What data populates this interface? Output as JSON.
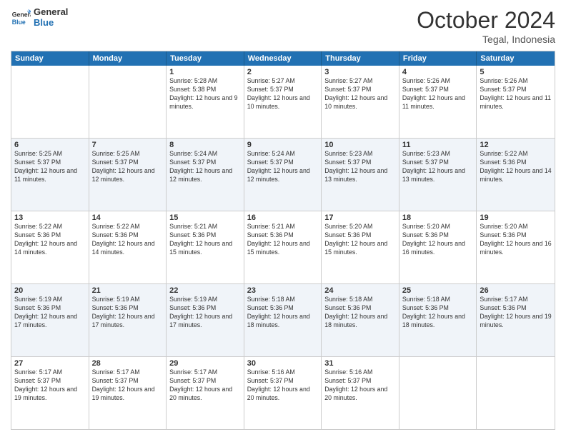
{
  "logo": {
    "line1": "General",
    "line2": "Blue"
  },
  "title": "October 2024",
  "location": "Tegal, Indonesia",
  "header_days": [
    "Sunday",
    "Monday",
    "Tuesday",
    "Wednesday",
    "Thursday",
    "Friday",
    "Saturday"
  ],
  "rows": [
    {
      "alt": false,
      "cells": [
        {
          "day": "",
          "info": ""
        },
        {
          "day": "",
          "info": ""
        },
        {
          "day": "1",
          "info": "Sunrise: 5:28 AM\nSunset: 5:38 PM\nDaylight: 12 hours and 9 minutes."
        },
        {
          "day": "2",
          "info": "Sunrise: 5:27 AM\nSunset: 5:37 PM\nDaylight: 12 hours and 10 minutes."
        },
        {
          "day": "3",
          "info": "Sunrise: 5:27 AM\nSunset: 5:37 PM\nDaylight: 12 hours and 10 minutes."
        },
        {
          "day": "4",
          "info": "Sunrise: 5:26 AM\nSunset: 5:37 PM\nDaylight: 12 hours and 11 minutes."
        },
        {
          "day": "5",
          "info": "Sunrise: 5:26 AM\nSunset: 5:37 PM\nDaylight: 12 hours and 11 minutes."
        }
      ]
    },
    {
      "alt": true,
      "cells": [
        {
          "day": "6",
          "info": "Sunrise: 5:25 AM\nSunset: 5:37 PM\nDaylight: 12 hours and 11 minutes."
        },
        {
          "day": "7",
          "info": "Sunrise: 5:25 AM\nSunset: 5:37 PM\nDaylight: 12 hours and 12 minutes."
        },
        {
          "day": "8",
          "info": "Sunrise: 5:24 AM\nSunset: 5:37 PM\nDaylight: 12 hours and 12 minutes."
        },
        {
          "day": "9",
          "info": "Sunrise: 5:24 AM\nSunset: 5:37 PM\nDaylight: 12 hours and 12 minutes."
        },
        {
          "day": "10",
          "info": "Sunrise: 5:23 AM\nSunset: 5:37 PM\nDaylight: 12 hours and 13 minutes."
        },
        {
          "day": "11",
          "info": "Sunrise: 5:23 AM\nSunset: 5:37 PM\nDaylight: 12 hours and 13 minutes."
        },
        {
          "day": "12",
          "info": "Sunrise: 5:22 AM\nSunset: 5:36 PM\nDaylight: 12 hours and 14 minutes."
        }
      ]
    },
    {
      "alt": false,
      "cells": [
        {
          "day": "13",
          "info": "Sunrise: 5:22 AM\nSunset: 5:36 PM\nDaylight: 12 hours and 14 minutes."
        },
        {
          "day": "14",
          "info": "Sunrise: 5:22 AM\nSunset: 5:36 PM\nDaylight: 12 hours and 14 minutes."
        },
        {
          "day": "15",
          "info": "Sunrise: 5:21 AM\nSunset: 5:36 PM\nDaylight: 12 hours and 15 minutes."
        },
        {
          "day": "16",
          "info": "Sunrise: 5:21 AM\nSunset: 5:36 PM\nDaylight: 12 hours and 15 minutes."
        },
        {
          "day": "17",
          "info": "Sunrise: 5:20 AM\nSunset: 5:36 PM\nDaylight: 12 hours and 15 minutes."
        },
        {
          "day": "18",
          "info": "Sunrise: 5:20 AM\nSunset: 5:36 PM\nDaylight: 12 hours and 16 minutes."
        },
        {
          "day": "19",
          "info": "Sunrise: 5:20 AM\nSunset: 5:36 PM\nDaylight: 12 hours and 16 minutes."
        }
      ]
    },
    {
      "alt": true,
      "cells": [
        {
          "day": "20",
          "info": "Sunrise: 5:19 AM\nSunset: 5:36 PM\nDaylight: 12 hours and 17 minutes."
        },
        {
          "day": "21",
          "info": "Sunrise: 5:19 AM\nSunset: 5:36 PM\nDaylight: 12 hours and 17 minutes."
        },
        {
          "day": "22",
          "info": "Sunrise: 5:19 AM\nSunset: 5:36 PM\nDaylight: 12 hours and 17 minutes."
        },
        {
          "day": "23",
          "info": "Sunrise: 5:18 AM\nSunset: 5:36 PM\nDaylight: 12 hours and 18 minutes."
        },
        {
          "day": "24",
          "info": "Sunrise: 5:18 AM\nSunset: 5:36 PM\nDaylight: 12 hours and 18 minutes."
        },
        {
          "day": "25",
          "info": "Sunrise: 5:18 AM\nSunset: 5:36 PM\nDaylight: 12 hours and 18 minutes."
        },
        {
          "day": "26",
          "info": "Sunrise: 5:17 AM\nSunset: 5:36 PM\nDaylight: 12 hours and 19 minutes."
        }
      ]
    },
    {
      "alt": false,
      "cells": [
        {
          "day": "27",
          "info": "Sunrise: 5:17 AM\nSunset: 5:37 PM\nDaylight: 12 hours and 19 minutes."
        },
        {
          "day": "28",
          "info": "Sunrise: 5:17 AM\nSunset: 5:37 PM\nDaylight: 12 hours and 19 minutes."
        },
        {
          "day": "29",
          "info": "Sunrise: 5:17 AM\nSunset: 5:37 PM\nDaylight: 12 hours and 20 minutes."
        },
        {
          "day": "30",
          "info": "Sunrise: 5:16 AM\nSunset: 5:37 PM\nDaylight: 12 hours and 20 minutes."
        },
        {
          "day": "31",
          "info": "Sunrise: 5:16 AM\nSunset: 5:37 PM\nDaylight: 12 hours and 20 minutes."
        },
        {
          "day": "",
          "info": ""
        },
        {
          "day": "",
          "info": ""
        }
      ]
    }
  ]
}
